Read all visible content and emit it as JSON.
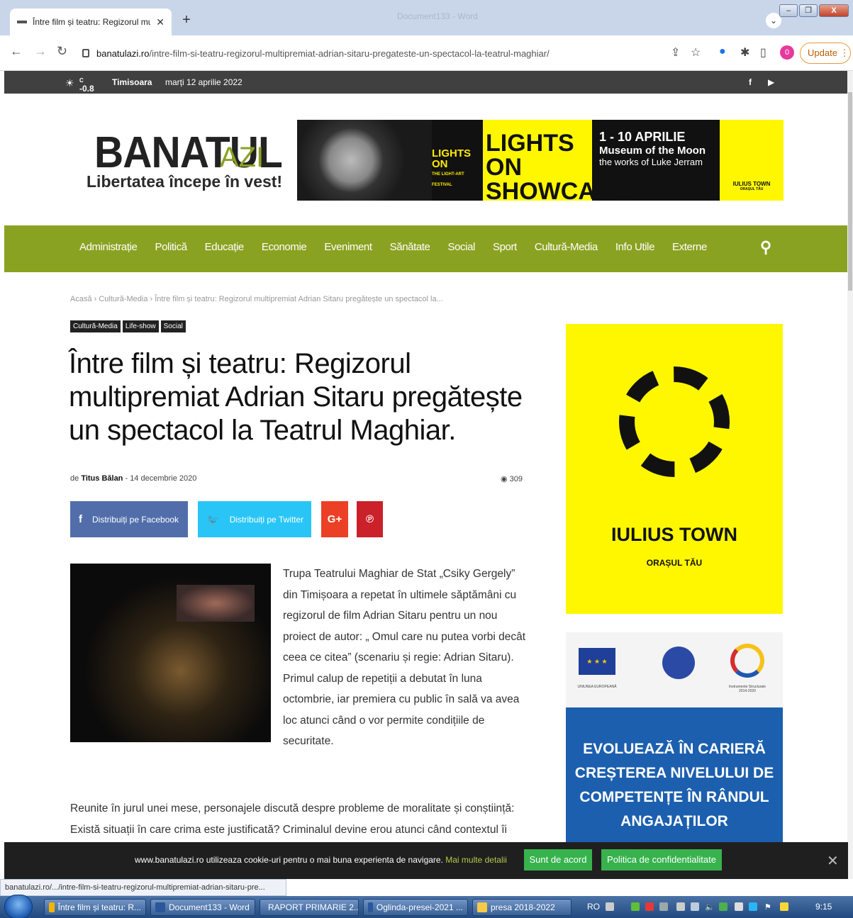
{
  "browser": {
    "tab_title": "Între film și teatru: Regizorul mult",
    "window_title": "Document133 - Word",
    "url_host": "banatulazi.ro",
    "url_path": "/intre-film-si-teatru-regizorul-multipremiat-adrian-sitaru-pregateste-un-spectacol-la-teatrul-maghiar/",
    "update_label": "Update",
    "profile_badge": "0"
  },
  "topbar": {
    "temperature": "-0.8",
    "temp_unit": "C",
    "city": "Timisoara",
    "date": "marți 12 aprilie 2022"
  },
  "logo": {
    "brand": "BANATUL",
    "suffix": "AZI",
    "tagline": "Libertatea începe în vest!"
  },
  "banner": {
    "lights_on": "LIGHTS ON",
    "festival": "THE LIGHT-ART FESTIVAL",
    "showcase": "LIGHTS ON SHOWCASE",
    "dates": "1 - 10 APRILIE",
    "museum": "Museum of the Moon",
    "works": "the works of Luke Jerram",
    "iulius": "IULIUS TOWN",
    "iulius_sub": "ORAȘUL TĂU"
  },
  "nav": {
    "items": [
      "Administrație",
      "Politică",
      "Educație",
      "Economie",
      "Eveniment",
      "Sănătate",
      "Social",
      "Sport",
      "Cultură-Media",
      "Info Utile",
      "Externe"
    ]
  },
  "article": {
    "breadcrumb": "Acasă  ›  Cultură-Media  ›  Între film și teatru: Regizorul multipremiat Adrian Sitaru pregătește un spectacol la...",
    "tags": [
      "Cultură-Media",
      "Life-show",
      "Social"
    ],
    "title": "Între film și teatru: Regizorul multipremiat Adrian Sitaru pregătește un spectacol la Teatrul Maghiar.",
    "by": "de",
    "author": "Titus Bălan",
    "date": "14 decembrie 2020",
    "views": "309",
    "share_facebook": "Distribuiți pe Facebook",
    "share_twitter": "Distribuiți pe Twitter",
    "paragraph1": "Trupa Teatrului Maghiar de Stat „Csiky Gergely” din Timișoara a repetat în ultimele săptămâni cu regizorul de film Adrian Sitaru pentru un nou proiect de autor: „ Omul care nu putea vorbi decât ceea ce citea” (scenariu și regie: Adrian Sitaru). Primul calup de repetiții a debutat în luna octombrie, iar premiera cu public în sală va avea loc atunci când o vor permite condițiile de securitate.",
    "paragraph2": "Reunite în jurul unei mese, personajele discută despre probleme de moralitate și conștiință: Există situații în care crima este justificată? Criminalul devine erou atunci când contextul îi"
  },
  "sidebar": {
    "ad1_title": "IULIUS TOWN",
    "ad1_sub": "ORAȘUL TĂU",
    "eu_caption": "UNIUNEA EUROPEANĂ",
    "is_caption": "Instrumente Structurale 2014-2020",
    "ad3_text": "EVOLUEAZĂ ÎN CARIERĂ CREȘTEREA NIVELULUI DE COMPETENȚE ÎN RÂNDUL ANGAJAȚILOR"
  },
  "cookie": {
    "text": "www.banatulazi.ro utilizeaza cookie-uri pentru o mai buna experienta de navigare.",
    "more": "Mai multe detalii",
    "accept": "Sunt de acord",
    "policy": "Politica de confidentialitate"
  },
  "status_url": "banatulazi.ro/.../intre-film-si-teatru-regizorul-multipremiat-adrian-sitaru-pre...",
  "taskbar": {
    "items": [
      "Între film și teatru: R...",
      "Document133 - Word",
      "RAPORT PRIMARIE 2...",
      "Oglinda-presei-2021 ...",
      "presa 2018-2022"
    ],
    "lang": "RO",
    "time": "9:15"
  },
  "colors": {
    "nav_green": "#8aa221",
    "iulius_yellow": "#fff700",
    "facebook": "#516eab",
    "twitter": "#29c5f6"
  }
}
